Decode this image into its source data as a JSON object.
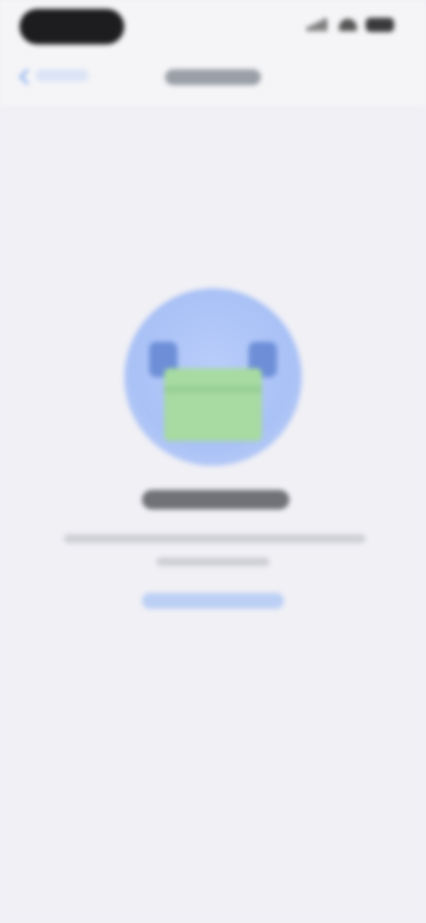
{
  "colors": {
    "background": "#f0f0f5",
    "accent": "#4a7be8",
    "illustration_circle": "#b0c7f8",
    "illustration_box": "#a7dba1"
  },
  "icons": {
    "back": "chevron-left-icon",
    "signal": "signal-icon",
    "wifi": "wifi-icon",
    "battery": "battery-icon",
    "illustration": "box-illustration"
  }
}
